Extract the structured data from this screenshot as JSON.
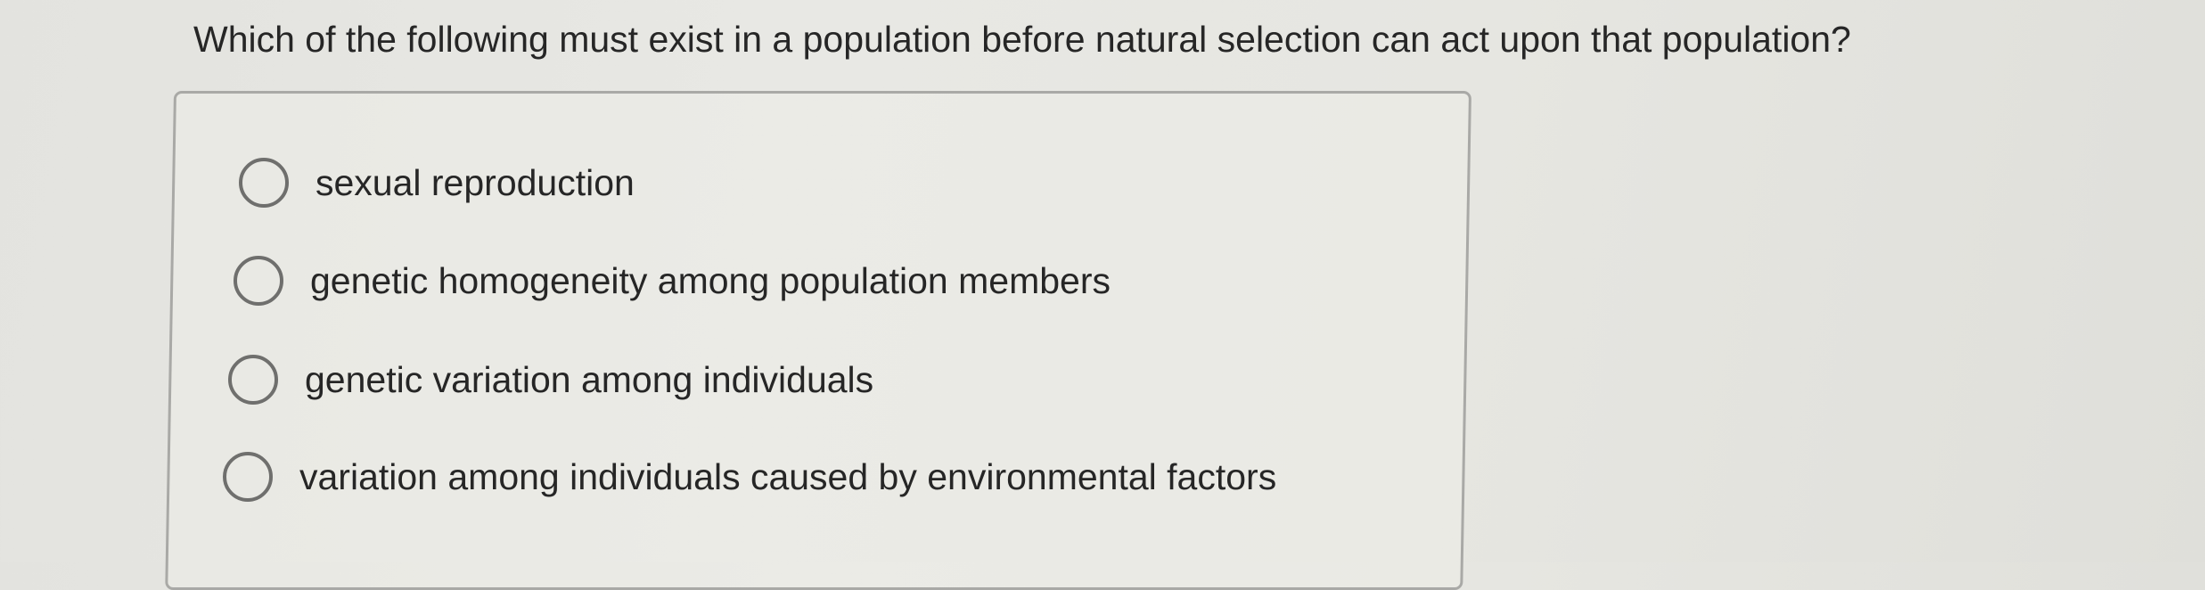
{
  "question": {
    "text": "Which of the following must exist in a population before natural selection can act upon that population?"
  },
  "options": [
    {
      "label": "sexual reproduction",
      "selected": false
    },
    {
      "label": "genetic homogeneity among population members",
      "selected": false
    },
    {
      "label": "genetic variation among individuals",
      "selected": false
    },
    {
      "label": "variation among individuals caused by environmental factors",
      "selected": false
    }
  ],
  "colors": {
    "background": "#e6e6e1",
    "text": "#262626",
    "radio_border": "#6f6f6d",
    "box_border": "#a9a9a6"
  }
}
